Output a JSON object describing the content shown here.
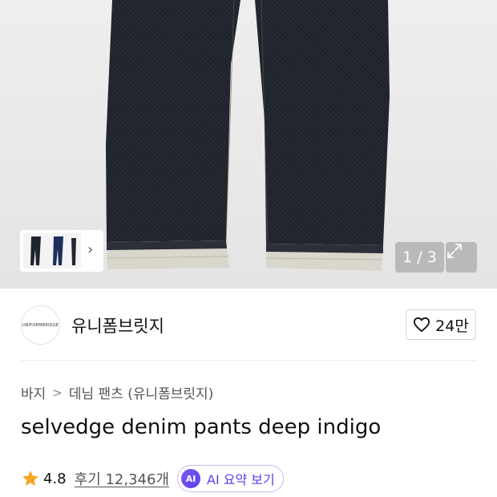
{
  "gallery": {
    "counter": "1 / 3",
    "expand_icon": "expand-icon",
    "thumb_arrow": "chevron-right-icon"
  },
  "brand": {
    "logo_text": "UNIFORMBRIDGE",
    "name": "유니폼브릿지",
    "like_count": "24만"
  },
  "breadcrumb": {
    "items": [
      "바지",
      "데님 팬츠 (유니폼브릿지)"
    ],
    "separator": ">"
  },
  "product": {
    "title": "selvedge denim pants deep indigo"
  },
  "rating": {
    "score": "4.8",
    "reviews": "후기 12,346개"
  },
  "ai_summary": {
    "badge": "AI",
    "label": "AI 요약 보기"
  },
  "colors": {
    "denim": "#1f232c",
    "selvedge": "#d9d6cc",
    "star": "#f5a623",
    "ai_accent": "#5b3ee6"
  }
}
